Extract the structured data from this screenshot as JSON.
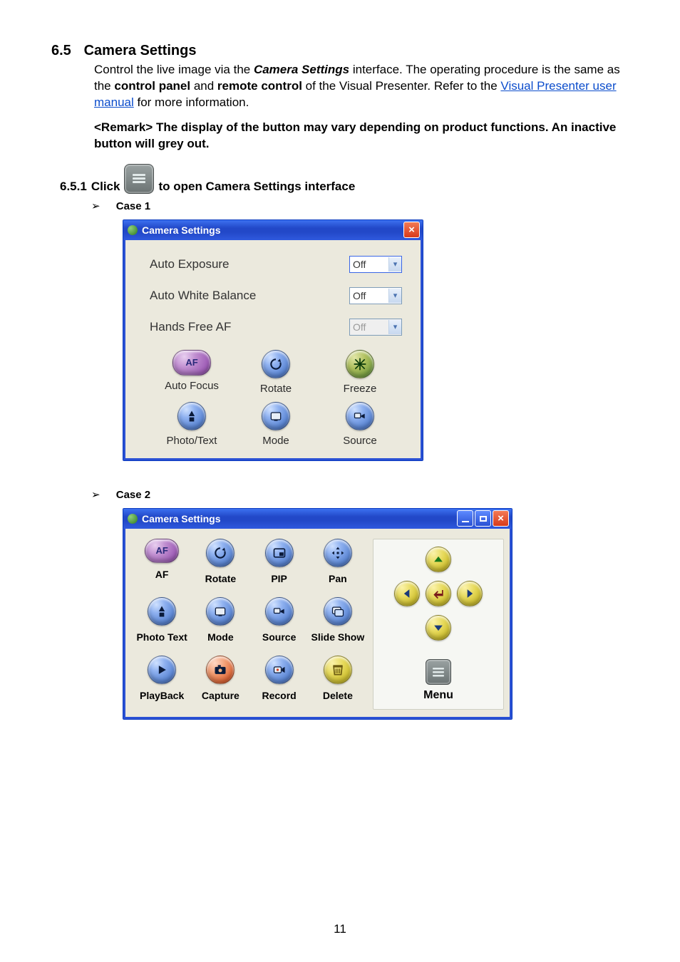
{
  "section": {
    "number": "6.5",
    "title": "Camera Settings"
  },
  "intro": {
    "t1": "Control the live image via the ",
    "bold_italic": "Camera Settings",
    "t2": " interface. The operating procedure is the same as the ",
    "b1": "control panel",
    "t3": " and ",
    "b2": "remote control",
    "t4": " of the Visual Presenter. Refer to the ",
    "link": "Visual Presenter user manual",
    "t5": " for more information."
  },
  "remark": "<Remark> The display of the button may vary depending on product functions. An inactive button will grey out.",
  "sub": {
    "num": "6.5.1",
    "before": "Click",
    "after": "to open Camera Settings interface"
  },
  "case1_label": "Case 1",
  "case2_label": "Case 2",
  "win_title": "Camera Settings",
  "row1": {
    "label": "Auto Exposure",
    "value": "Off",
    "state": "focused"
  },
  "row2": {
    "label": "Auto White Balance",
    "value": "Off",
    "state": "normal"
  },
  "row3": {
    "label": "Hands Free AF",
    "value": "Off",
    "state": "disabled"
  },
  "c1_btns": {
    "af": {
      "label": "Auto Focus",
      "glyph": "AF"
    },
    "rotate": {
      "label": "Rotate"
    },
    "freeze": {
      "label": "Freeze"
    },
    "phototext": {
      "label": "Photo/Text"
    },
    "mode": {
      "label": "Mode"
    },
    "source": {
      "label": "Source"
    }
  },
  "c2_btns": {
    "af": {
      "label": "AF",
      "glyph": "AF"
    },
    "rotate": {
      "label": "Rotate"
    },
    "pip": {
      "label": "PIP"
    },
    "pan": {
      "label": "Pan"
    },
    "phototext": {
      "label": "Photo Text"
    },
    "mode": {
      "label": "Mode"
    },
    "source": {
      "label": "Source"
    },
    "slideshow": {
      "label": "Slide Show"
    },
    "playback": {
      "label": "PlayBack"
    },
    "capture": {
      "label": "Capture"
    },
    "record": {
      "label": "Record"
    },
    "delete": {
      "label": "Delete"
    }
  },
  "menu_label": "Menu",
  "page_number": "11"
}
